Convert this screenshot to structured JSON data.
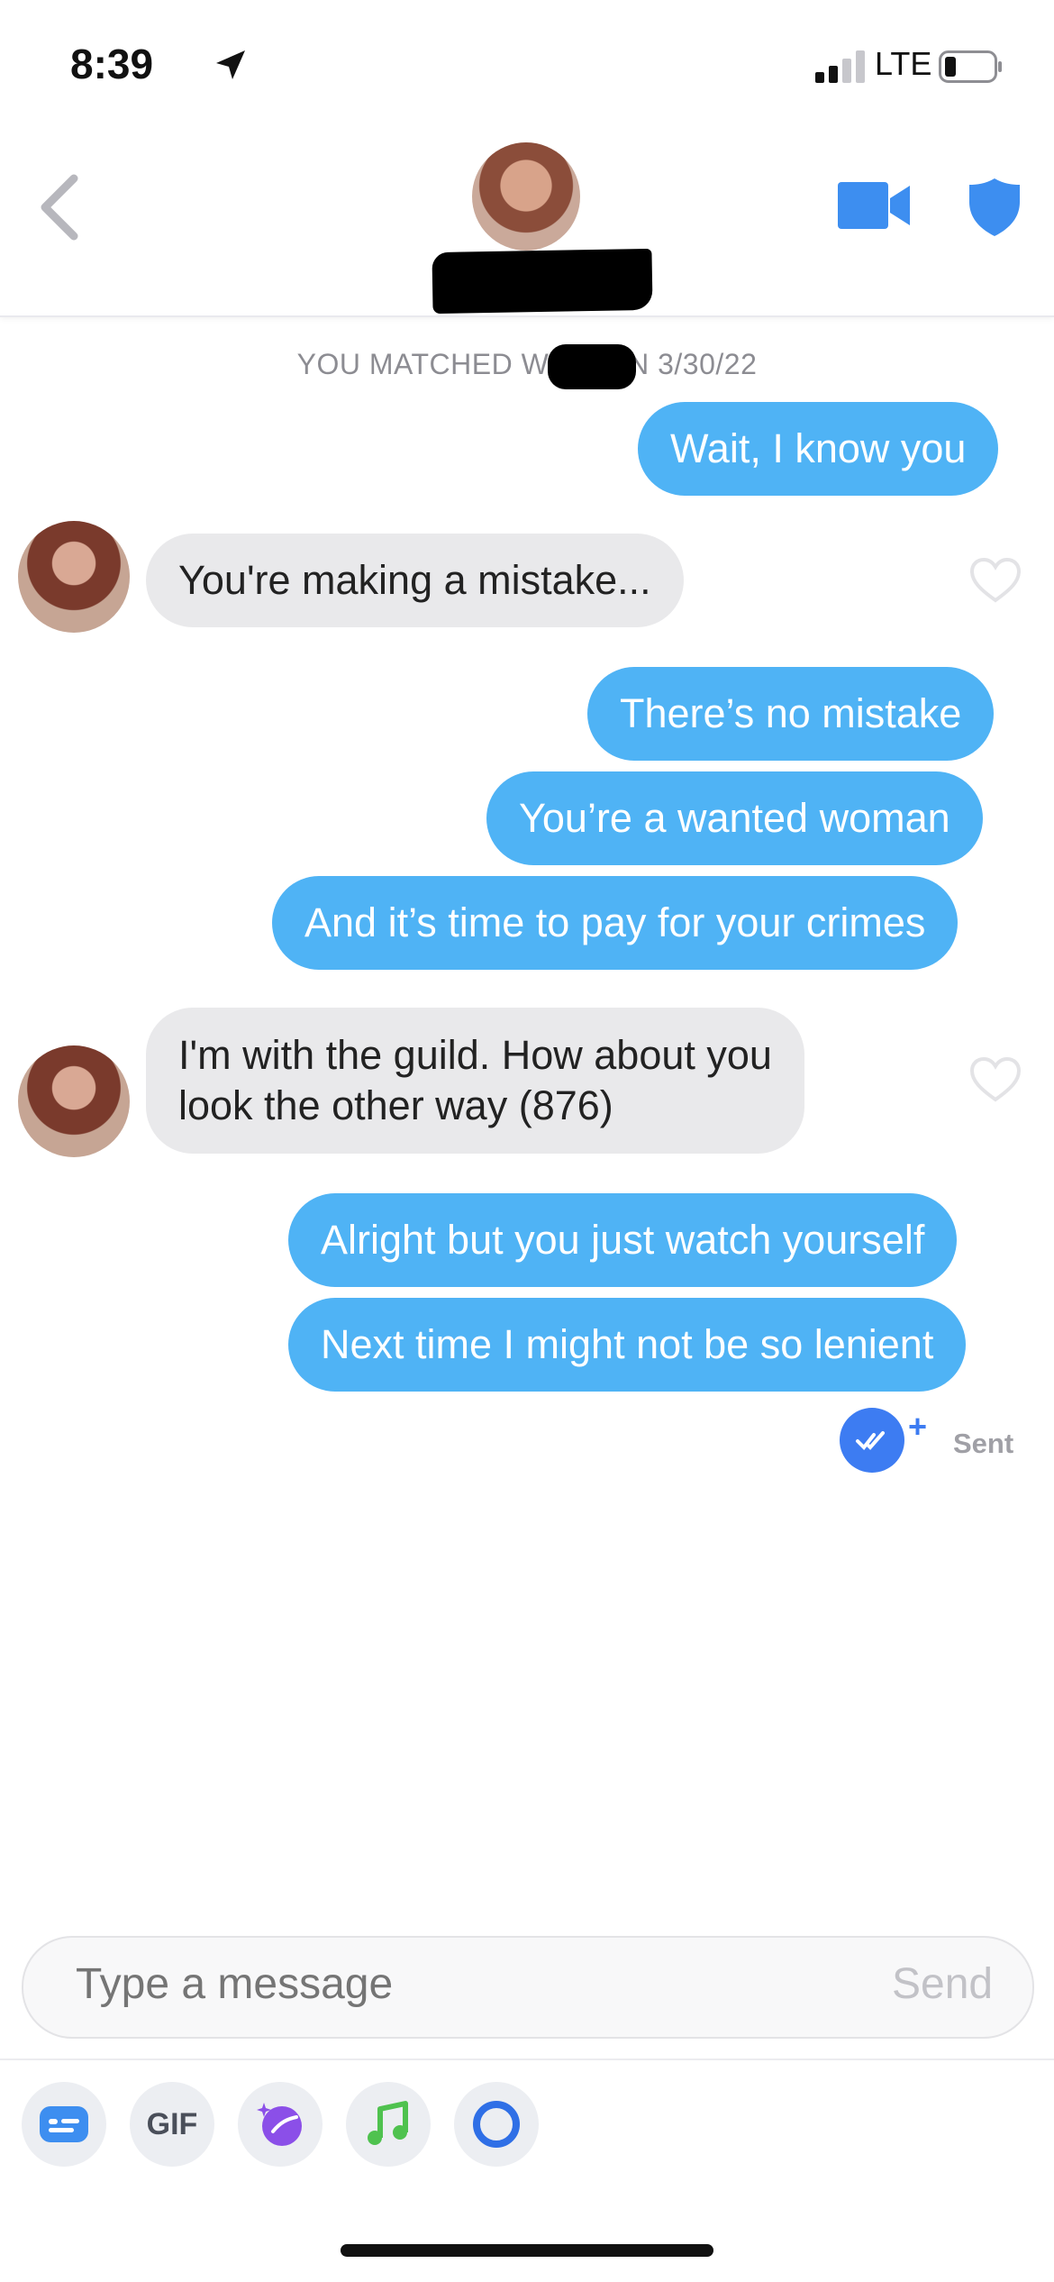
{
  "status_bar": {
    "time": "8:39",
    "network": "LTE"
  },
  "header": {
    "match_notice": "YOU MATCHED WITH          ON 3/30/22"
  },
  "messages": [
    {
      "dir": "out",
      "text": "Wait, I know you"
    },
    {
      "dir": "in",
      "text": "You're making a mistake..."
    },
    {
      "dir": "out",
      "text": "There’s no mistake"
    },
    {
      "dir": "out",
      "text": "You’re a wanted woman"
    },
    {
      "dir": "out",
      "text": "And it’s time to pay for your crimes"
    },
    {
      "dir": "in",
      "line1": "I'm with the guild. How about you",
      "line2": "look the other way (876)"
    },
    {
      "dir": "out",
      "text": "Alright but you just watch yourself"
    },
    {
      "dir": "out",
      "text": "Next time I might not be so lenient"
    }
  ],
  "status": {
    "plus": "+",
    "sent": "Sent"
  },
  "composer": {
    "placeholder": "Type a message",
    "send": "Send"
  },
  "toolbar": {
    "gif": "GIF"
  },
  "colors": {
    "outgoing": "#4fb3f5",
    "incoming": "#e9e9eb",
    "accent": "#3d7cf2"
  },
  "icons": [
    "back-chevron-icon",
    "video-call-icon",
    "shield-icon",
    "heart-icon",
    "read-receipt-icon",
    "card-icon",
    "sparkle-icon",
    "music-icon",
    "ring-icon"
  ]
}
